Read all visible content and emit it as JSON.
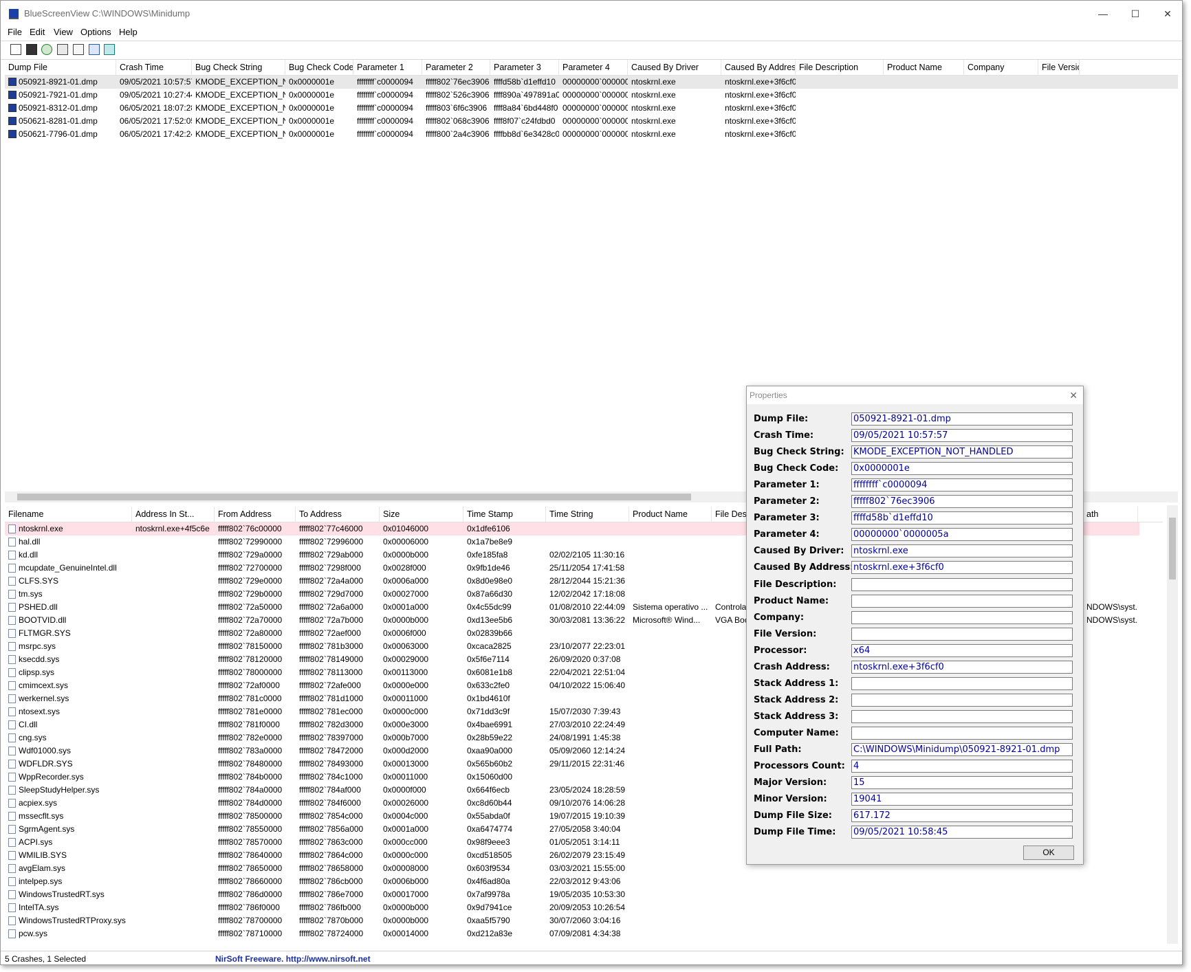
{
  "window": {
    "title": "BlueScreenView    C:\\WINDOWS\\Minidump",
    "minimize": "—",
    "maximize": "☐",
    "close": "✕"
  },
  "menu": [
    "File",
    "Edit",
    "View",
    "Options",
    "Help"
  ],
  "toolbar_icons": [
    "properties-icon",
    "save-icon",
    "refresh-icon",
    "copy-icon",
    "html-report-icon",
    "find-icon",
    "exit-icon"
  ],
  "top_table": {
    "headers": [
      "Dump File",
      "Crash Time",
      "Bug Check String",
      "Bug Check Code",
      "Parameter 1",
      "Parameter 2",
      "Parameter 3",
      "Parameter 4",
      "Caused By Driver",
      "Caused By Address",
      "File Description",
      "Product Name",
      "Company",
      "File Versio"
    ],
    "rows": [
      [
        "050921-8921-01.dmp",
        "09/05/2021 10:57:57",
        "KMODE_EXCEPTION_N...",
        "0x0000001e",
        "ffffffff`c0000094",
        "fffff802`76ec3906",
        "ffffd58b`d1effd10",
        "00000000`000000...",
        "ntoskrnl.exe",
        "ntoskrnl.exe+3f6cf0"
      ],
      [
        "050921-7921-01.dmp",
        "09/05/2021 10:27:44",
        "KMODE_EXCEPTION_N...",
        "0x0000001e",
        "ffffffff`c0000094",
        "fffff802`526c3906",
        "ffff890a`497891a0",
        "00000000`000000...",
        "ntoskrnl.exe",
        "ntoskrnl.exe+3f6cf0"
      ],
      [
        "050921-8312-01.dmp",
        "06/05/2021 18:07:28",
        "KMODE_EXCEPTION_N...",
        "0x0000001e",
        "ffffffff`c0000094",
        "fffff803`6f6c3906",
        "ffff8a84`6bd448f0",
        "00000000`000000...",
        "ntoskrnl.exe",
        "ntoskrnl.exe+3f6cf0"
      ],
      [
        "050621-8281-01.dmp",
        "06/05/2021 17:52:05",
        "KMODE_EXCEPTION_N...",
        "0x0000001e",
        "ffffffff`c0000094",
        "fffff802`068c3906",
        "ffff8f07`c24fdbd0",
        "00000000`000000...",
        "ntoskrnl.exe",
        "ntoskrnl.exe+3f6cf0"
      ],
      [
        "050621-7796-01.dmp",
        "06/05/2021 17:42:24",
        "KMODE_EXCEPTION_N...",
        "0x0000001e",
        "ffffffff`c0000094",
        "fffff800`2a4c3906",
        "ffffbb8d`6e3428c0",
        "00000000`000000...",
        "ntoskrnl.exe",
        "ntoskrnl.exe+3f6cf0"
      ]
    ]
  },
  "bottom_table": {
    "headers": [
      "Filename",
      "Address In St...",
      "From Address",
      "To Address",
      "Size",
      "Time Stamp",
      "Time String",
      "Product Name",
      "File Descri",
      "ath"
    ],
    "rows": [
      [
        "ntoskrnl.exe",
        "ntoskrnl.exe+4f5c6e",
        "fffff802`76c00000",
        "fffff802`77c46000",
        "0x01046000",
        "0x1dfe6106",
        "",
        "",
        "",
        ""
      ],
      [
        "hal.dll",
        "",
        "fffff802`72990000",
        "fffff802`72996000",
        "0x00006000",
        "0x1a7be8e9",
        "",
        "",
        "",
        ""
      ],
      [
        "kd.dll",
        "",
        "fffff802`729a0000",
        "fffff802`729ab000",
        "0x0000b000",
        "0xfe185fa8",
        "02/02/2105 11:30:16",
        "",
        "",
        ""
      ],
      [
        "mcupdate_GenuineIntel.dll",
        "",
        "fffff802`72700000",
        "fffff802`7298f000",
        "0x0028f000",
        "0x9fb1de46",
        "25/11/2054 17:41:58",
        "",
        "",
        ""
      ],
      [
        "CLFS.SYS",
        "",
        "fffff802`729e0000",
        "fffff802`72a4a000",
        "0x0006a000",
        "0x8d0e98e0",
        "28/12/2044 15:21:36",
        "",
        "",
        ""
      ],
      [
        "tm.sys",
        "",
        "fffff802`729b0000",
        "fffff802`729d7000",
        "0x00027000",
        "0x87a66d30",
        "12/02/2042 17:18:08",
        "",
        "",
        ""
      ],
      [
        "PSHED.dll",
        "",
        "fffff802`72a50000",
        "fffff802`72a6a000",
        "0x0001a000",
        "0x4c55dc99",
        "01/08/2010 22:44:09",
        "Sistema operativo ...",
        "Controlad",
        "NDOWS\\syst..."
      ],
      [
        "BOOTVID.dll",
        "",
        "fffff802`72a70000",
        "fffff802`72a7b000",
        "0x0000b000",
        "0xd13ee5b6",
        "30/03/2081 13:36:22",
        "Microsoft® Wind...",
        "VGA Boot",
        "NDOWS\\syst..."
      ],
      [
        "FLTMGR.SYS",
        "",
        "fffff802`72a80000",
        "fffff802`72aef000",
        "0x0006f000",
        "0x02839b66",
        "",
        "",
        "",
        ""
      ],
      [
        "msrpc.sys",
        "",
        "fffff802`78150000",
        "fffff802`781b3000",
        "0x00063000",
        "0xcaca2825",
        "23/10/2077 22:23:01",
        "",
        "",
        ""
      ],
      [
        "ksecdd.sys",
        "",
        "fffff802`78120000",
        "fffff802`78149000",
        "0x00029000",
        "0x5f6e7114",
        "26/09/2020 0:37:08",
        "",
        "",
        ""
      ],
      [
        "clipsp.sys",
        "",
        "fffff802`78000000",
        "fffff802`78113000",
        "0x00113000",
        "0x6081e1b8",
        "22/04/2021 22:51:04",
        "",
        "",
        ""
      ],
      [
        "cmimcext.sys",
        "",
        "fffff802`72af0000",
        "fffff802`72afe000",
        "0x0000e000",
        "0x633c2fe0",
        "04/10/2022 15:06:40",
        "",
        "",
        ""
      ],
      [
        "werkernel.sys",
        "",
        "fffff802`781c0000",
        "fffff802`781d1000",
        "0x00011000",
        "0x1bd4610f",
        "",
        "",
        "",
        ""
      ],
      [
        "ntosext.sys",
        "",
        "fffff802`781e0000",
        "fffff802`781ec000",
        "0x0000c000",
        "0x71dd3c9f",
        "15/07/2030 7:39:43",
        "",
        "",
        ""
      ],
      [
        "CI.dll",
        "",
        "fffff802`781f0000",
        "fffff802`782d3000",
        "0x000e3000",
        "0x4bae6991",
        "27/03/2010 22:24:49",
        "",
        "",
        ""
      ],
      [
        "cng.sys",
        "",
        "fffff802`782e0000",
        "fffff802`78397000",
        "0x000b7000",
        "0x28b59e22",
        "24/08/1991 1:45:38",
        "",
        "",
        ""
      ],
      [
        "Wdf01000.sys",
        "",
        "fffff802`783a0000",
        "fffff802`78472000",
        "0x000d2000",
        "0xaa90a000",
        "05/09/2060 12:14:24",
        "",
        "",
        ""
      ],
      [
        "WDFLDR.SYS",
        "",
        "fffff802`78480000",
        "fffff802`78493000",
        "0x00013000",
        "0x565b60b2",
        "29/11/2015 22:31:46",
        "",
        "",
        ""
      ],
      [
        "WppRecorder.sys",
        "",
        "fffff802`784b0000",
        "fffff802`784c1000",
        "0x00011000",
        "0x15060d00",
        "",
        "",
        "",
        ""
      ],
      [
        "SleepStudyHelper.sys",
        "",
        "fffff802`784a0000",
        "fffff802`784af000",
        "0x0000f000",
        "0x664f6ecb",
        "23/05/2024 18:28:59",
        "",
        "",
        ""
      ],
      [
        "acpiex.sys",
        "",
        "fffff802`784d0000",
        "fffff802`784f6000",
        "0x00026000",
        "0xc8d60b44",
        "09/10/2076 14:06:28",
        "",
        "",
        ""
      ],
      [
        "mssecflt.sys",
        "",
        "fffff802`78500000",
        "fffff802`7854c000",
        "0x0004c000",
        "0x55abda0f",
        "19/07/2015 19:10:39",
        "",
        "",
        ""
      ],
      [
        "SgrmAgent.sys",
        "",
        "fffff802`78550000",
        "fffff802`7856a000",
        "0x0001a000",
        "0xa6474774",
        "27/05/2058 3:40:04",
        "",
        "",
        ""
      ],
      [
        "ACPI.sys",
        "",
        "fffff802`78570000",
        "fffff802`7863c000",
        "0x000cc000",
        "0x98f9eee3",
        "01/05/2051 3:14:11",
        "",
        "",
        ""
      ],
      [
        "WMILIB.SYS",
        "",
        "fffff802`78640000",
        "fffff802`7864c000",
        "0x0000c000",
        "0xcd518505",
        "26/02/2079 23:15:49",
        "",
        "",
        ""
      ],
      [
        "avgElam.sys",
        "",
        "fffff802`78650000",
        "fffff802`78658000",
        "0x00008000",
        "0x603f9534",
        "03/03/2021 15:55:00",
        "",
        "",
        ""
      ],
      [
        "intelpep.sys",
        "",
        "fffff802`78660000",
        "fffff802`786cb000",
        "0x0006b000",
        "0x4f6ad80a",
        "22/03/2012 9:43:06",
        "",
        "",
        ""
      ],
      [
        "WindowsTrustedRT.sys",
        "",
        "fffff802`786d0000",
        "fffff802`786e7000",
        "0x00017000",
        "0x7af9978a",
        "19/05/2035 10:53:30",
        "",
        "",
        ""
      ],
      [
        "IntelTA.sys",
        "",
        "fffff802`786f0000",
        "fffff802`786fb000",
        "0x0000b000",
        "0x9d7941ce",
        "20/09/2053 10:26:54",
        "",
        "",
        ""
      ],
      [
        "WindowsTrustedRTProxy.sys",
        "",
        "fffff802`78700000",
        "fffff802`7870b000",
        "0x0000b000",
        "0xaa5f5790",
        "30/07/2060 3:04:16",
        "",
        "",
        ""
      ],
      [
        "pcw.sys",
        "",
        "fffff802`78710000",
        "fffff802`78724000",
        "0x00014000",
        "0xd212a83e",
        "07/09/2081 4:34:38",
        "",
        "",
        ""
      ]
    ]
  },
  "status": {
    "left": "5 Crashes, 1 Selected",
    "center": "NirSoft Freeware.  http://www.nirsoft.net"
  },
  "properties": {
    "title": "Properties",
    "close": "✕",
    "ok": "OK",
    "fields": [
      [
        "Dump File:",
        "050921-8921-01.dmp"
      ],
      [
        "Crash Time:",
        "09/05/2021 10:57:57"
      ],
      [
        "Bug Check String:",
        "KMODE_EXCEPTION_NOT_HANDLED"
      ],
      [
        "Bug Check Code:",
        "0x0000001e"
      ],
      [
        "Parameter 1:",
        "ffffffff`c0000094"
      ],
      [
        "Parameter 2:",
        "fffff802`76ec3906"
      ],
      [
        "Parameter 3:",
        "ffffd58b`d1effd10"
      ],
      [
        "Parameter 4:",
        "00000000`0000005a"
      ],
      [
        "Caused By Driver:",
        "ntoskrnl.exe"
      ],
      [
        "Caused By Address:",
        "ntoskrnl.exe+3f6cf0"
      ],
      [
        "File Description:",
        ""
      ],
      [
        "Product Name:",
        ""
      ],
      [
        "Company:",
        ""
      ],
      [
        "File Version:",
        ""
      ],
      [
        "Processor:",
        "x64"
      ],
      [
        "Crash Address:",
        "ntoskrnl.exe+3f6cf0"
      ],
      [
        "Stack Address 1:",
        ""
      ],
      [
        "Stack Address 2:",
        ""
      ],
      [
        "Stack Address 3:",
        ""
      ],
      [
        "Computer Name:",
        ""
      ],
      [
        "Full Path:",
        "C:\\WINDOWS\\Minidump\\050921-8921-01.dmp"
      ],
      [
        "Processors Count:",
        "4"
      ],
      [
        "Major Version:",
        "15"
      ],
      [
        "Minor Version:",
        "19041"
      ],
      [
        "Dump File Size:",
        "617.172"
      ],
      [
        "Dump File Time:",
        "09/05/2021 10:58:45"
      ]
    ]
  }
}
